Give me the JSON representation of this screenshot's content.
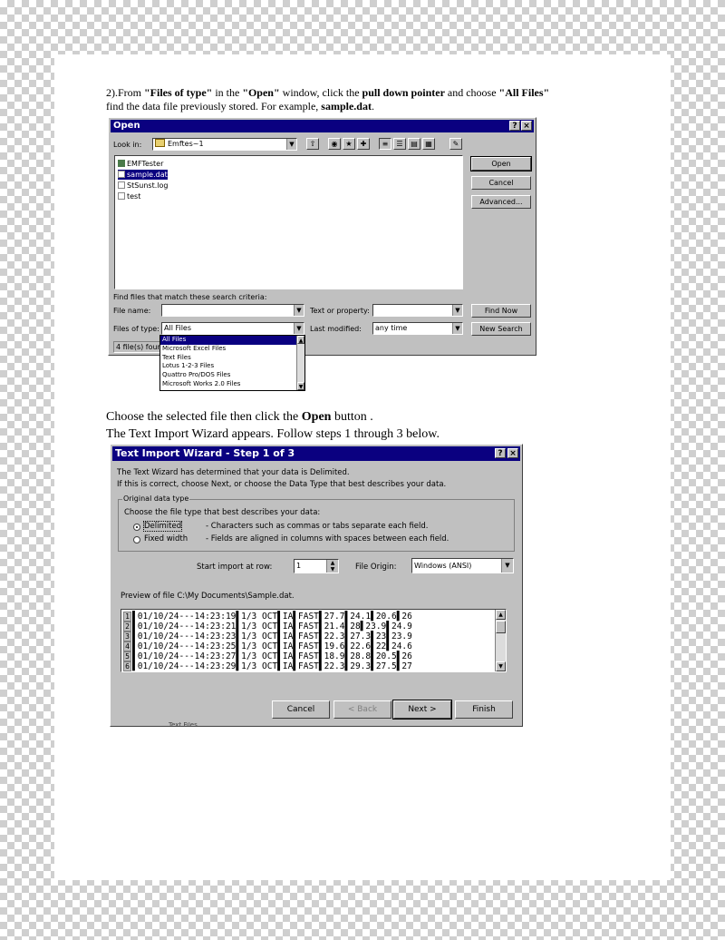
{
  "instructions": {
    "step2_parts": [
      "2).From ",
      "\"Files of type\"",
      " in the ",
      "\"Open\"",
      " window, click the ",
      "pull down pointer",
      " and choose ",
      "\"All Files\""
    ],
    "step2_line2_parts": [
      "find the data file previously stored. For example, ",
      "sample.dat",
      "."
    ],
    "choose_parts": [
      "Choose the selected file then click the ",
      "Open",
      " button ."
    ],
    "wizard_intro": "The Text Import Wizard appears. Follow steps 1 through 3 below."
  },
  "open_dialog": {
    "title": "Open",
    "help_btn": "?",
    "close_btn": "×",
    "look_in_label": "Look in:",
    "look_in_value": "Emftes~1",
    "files": [
      {
        "name": "EMFTester",
        "icon": "folder-exe-icon",
        "selected": false
      },
      {
        "name": "sample.dat",
        "icon": "file-icon",
        "selected": true
      },
      {
        "name": "StSunst.log",
        "icon": "file-icon",
        "selected": false
      },
      {
        "name": "test",
        "icon": "file-icon",
        "selected": false
      }
    ],
    "buttons": {
      "open": "Open",
      "cancel": "Cancel",
      "advanced": "Advanced..."
    },
    "find_files_label": "Find files that match these search criteria:",
    "file_name_label": "File name:",
    "files_of_type_label": "Files of type:",
    "files_of_type_value": "All Files",
    "text_property_label": "Text or property:",
    "last_modified_label": "Last modified:",
    "last_modified_value": "any time",
    "find_now": "Find Now",
    "new_search": "New Search",
    "status": "4 file(s) found",
    "dropdown_options": [
      "All Files",
      "Microsoft Excel Files",
      "Text Files",
      "Lotus 1-2-3 Files",
      "Quattro Pro/DOS Files",
      "Microsoft Works 2.0 Files"
    ]
  },
  "wizard": {
    "title": "Text Import Wizard - Step 1 of 3",
    "help_btn": "?",
    "close_btn": "×",
    "desc1": "The Text Wizard has determined that your data is Delimited.",
    "desc2": "If this is correct, choose Next, or choose the Data Type that best describes your data.",
    "group_title": "Original data type",
    "choose_label": "Choose the file type that best describes your data:",
    "radio_delimited": "Delimited",
    "radio_delimited_desc": "- Characters such as commas or tabs separate each field.",
    "radio_fixed": "Fixed width",
    "radio_fixed_desc": "- Fields are aligned in columns with spaces between each field.",
    "start_row_label": "Start import at row:",
    "start_row_value": "1",
    "file_origin_label": "File Origin:",
    "file_origin_value": "Windows (ANSI)",
    "preview_label": "Preview of file C:\\My Documents\\Sample.dat.",
    "preview_rows": [
      {
        "n": "1",
        "text": "▌01/10/24---14:23:19▌1/3 OCT▌IA▌FAST▌27.7▌24.1▌20.6▌26"
      },
      {
        "n": "2",
        "text": "▌01/10/24---14:23:21▌1/3 OCT▌IA▌FAST▌21.4▌28▌23.9▌24.9"
      },
      {
        "n": "3",
        "text": "▌01/10/24---14:23:23▌1/3 OCT▌IA▌FAST▌22.3▌27.3▌23▌23.9"
      },
      {
        "n": "4",
        "text": "▌01/10/24---14:23:25▌1/3 OCT▌IA▌FAST▌19.6▌22.6▌22▌24.6"
      },
      {
        "n": "5",
        "text": "▌01/10/24---14:23:27▌1/3 OCT▌IA▌FAST▌18.9▌28.8▌20.5▌26"
      },
      {
        "n": "6",
        "text": "▌01/10/24---14:23:29▌1/3 OCT▌IA▌FAST▌22.3▌29.3▌27.5▌27"
      }
    ],
    "buttons": {
      "cancel": "Cancel",
      "back": "< Back",
      "next": "Next >",
      "finish": "Finish"
    },
    "overlap_text": "Text Files"
  }
}
